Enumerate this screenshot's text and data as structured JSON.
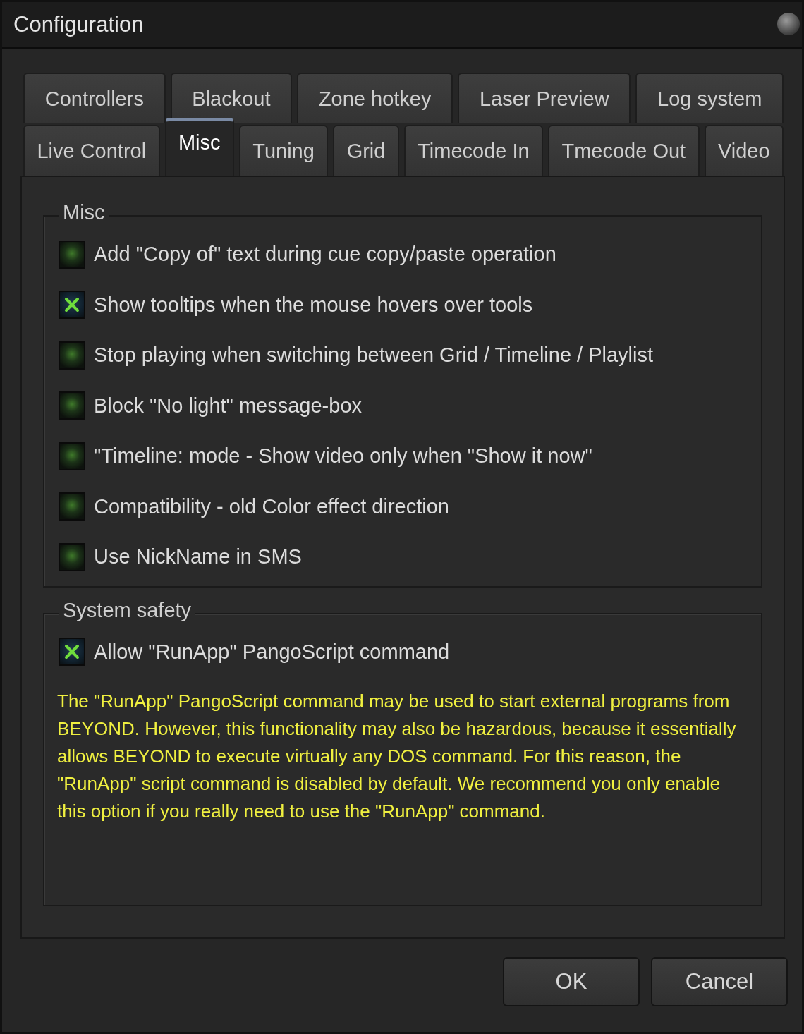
{
  "window": {
    "title": "Configuration"
  },
  "tab_rows": [
    [
      {
        "label": "Controllers",
        "selected": false
      },
      {
        "label": "Blackout",
        "selected": false
      },
      {
        "label": "Zone hotkey",
        "selected": false
      },
      {
        "label": "Laser Preview",
        "selected": false
      },
      {
        "label": "Log system",
        "selected": false
      }
    ],
    [
      {
        "label": "Live Control",
        "selected": false
      },
      {
        "label": "Misc",
        "selected": true
      },
      {
        "label": "Tuning",
        "selected": false
      },
      {
        "label": "Grid",
        "selected": false
      },
      {
        "label": "Timecode In",
        "selected": false
      },
      {
        "label": "Tmecode Out",
        "selected": false
      },
      {
        "label": "Video",
        "selected": false
      }
    ]
  ],
  "groups": [
    {
      "title": "Misc",
      "options": [
        {
          "label": "Add \"Copy of\" text during cue copy/paste operation",
          "checked": false
        },
        {
          "label": "Show tooltips when the mouse hovers over tools",
          "checked": true
        },
        {
          "label": "Stop playing when switching between Grid / Timeline / Playlist",
          "checked": false
        },
        {
          "label": "Block \"No light\" message-box",
          "checked": false
        },
        {
          "label": "\"Timeline: mode - Show video only when \"Show it now\"",
          "checked": false
        },
        {
          "label": "Compatibility - old Color effect direction",
          "checked": false
        },
        {
          "label": "Use NickName in SMS",
          "checked": false
        }
      ]
    },
    {
      "title": "System safety",
      "options": [
        {
          "label": "Allow \"RunApp\" PangoScript command",
          "checked": true
        }
      ],
      "note": "The \"RunApp\" PangoScript command may be used to start external programs from BEYOND. However, this functionality may also be hazardous, because it essentially allows BEYOND to execute virtually any DOS command. For this reason, the \"RunApp\" script command is disabled by default. We recommend you only enable this option if you really need to use the \"RunApp\" command."
    }
  ],
  "buttons": [
    "OK",
    "Cancel"
  ]
}
